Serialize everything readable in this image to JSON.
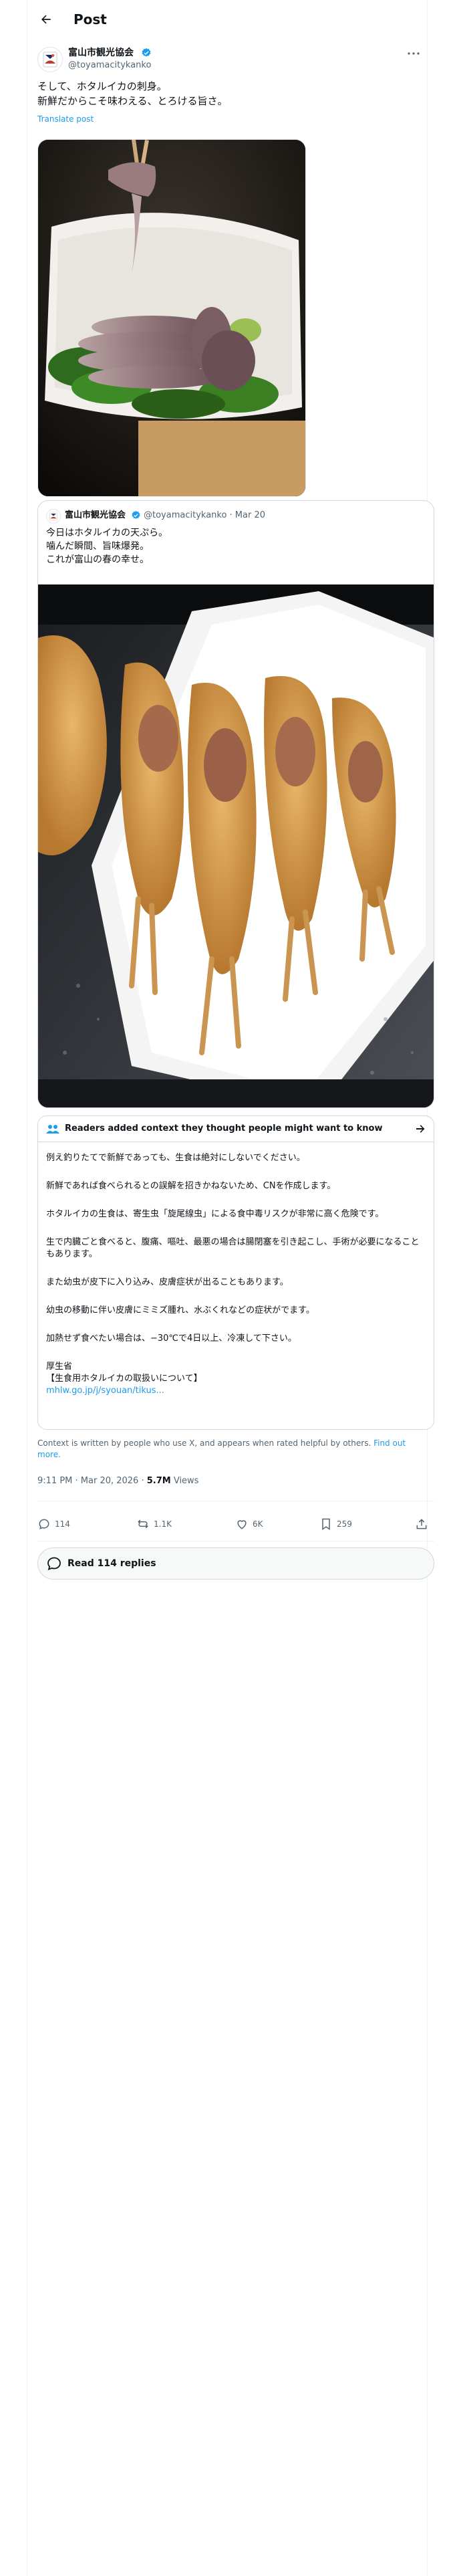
{
  "header": {
    "title": "Post"
  },
  "post": {
    "author": {
      "name": "富山市観光協会",
      "handle": "@toyamacitykanko"
    },
    "text": "そして、ホタルイカの刺身。\n新鮮だからこそ味わえる、とろける旨さ。",
    "translate_label": "Translate post",
    "timestamp": "9:11 PM · Mar 20, 2026 · ",
    "views_value": "5.7M",
    "views_label": " Views"
  },
  "quote": {
    "author": {
      "name": "富山市観光協会",
      "handle_date": "@toyamacitykanko · Mar 20"
    },
    "text": "今日はホタルイカの天ぷら。\n噛んだ瞬間、旨味爆発。\nこれが富山の春の幸せ。"
  },
  "community_note": {
    "title": "Readers added context they thought people might want to know",
    "paragraphs": [
      "例え釣りたてで新鮮であっても、生食は絶対にしないでください。",
      "新鮮であれば食べられるとの誤解を招きかねないため、CNを作成します。",
      "ホタルイカの生食は、寄生虫「旋尾線虫」による食中毒リスクが非常に高く危険です。",
      "生で内臓ごと食べると、腹痛、嘔吐、最悪の場合は腸閉塞を引き起こし、手術が必要になることもあります。",
      "また幼虫が皮下に入り込み、皮膚症状が出ることもあります。",
      "幼虫の移動に伴い皮膚にミミズ腫れ、水ぶくれなどの症状がでます。",
      "加熱せず食べたい場合は、−30℃で4日以上、冷凍して下さい。",
      "厚生省\n【生食用ホタルイカの取扱いについて】"
    ],
    "link": "mhlw.go.jp/j/syouan/tikus..."
  },
  "disclaimer": {
    "text": "Context is written by people who use X, and appears when rated helpful by others. ",
    "link": "Find out more."
  },
  "actions": {
    "replies": "114",
    "reposts": "1.1K",
    "likes": "6K",
    "bookmarks": "259"
  },
  "read_replies": "Read 114 replies",
  "colors": {
    "accent": "#1d9bf0",
    "text": "#0f1419",
    "muted": "#536471",
    "border": "#cfd9de"
  },
  "icons": [
    "back-arrow-icon",
    "verified-badge-icon",
    "more-icon",
    "people-icon",
    "arrow-right-icon",
    "reply-icon",
    "repost-icon",
    "like-icon",
    "bookmark-icon",
    "share-icon",
    "chat-bubble-icon"
  ]
}
